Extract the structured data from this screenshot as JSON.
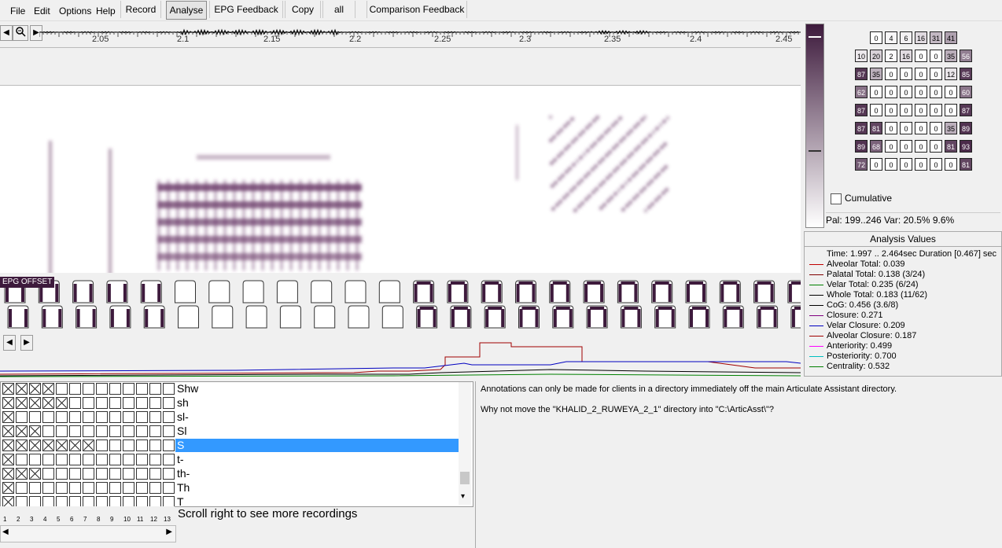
{
  "menu": {
    "file": "File",
    "edit": "Edit",
    "options": "Options",
    "help": "Help"
  },
  "toolbar": {
    "record": "Record",
    "analyse": "Analyse",
    "epg_feedback": "EPG Feedback",
    "copy": "Copy",
    "all": "all",
    "comparison_feedback": "Comparison Feedback"
  },
  "timeline": {
    "ticks": [
      "2.05",
      "2.1",
      "2.15",
      "2.2",
      "2.25",
      "2.3",
      "2.35",
      "2.4",
      "2.45"
    ]
  },
  "epg_offset_label": "EPG OFFSET",
  "epg_grid": [
    [
      null,
      0,
      4,
      6,
      16,
      31,
      41,
      null
    ],
    [
      10,
      20,
      2,
      16,
      0,
      0,
      35,
      56
    ],
    [
      87,
      35,
      0,
      0,
      0,
      0,
      12,
      85
    ],
    [
      62,
      0,
      0,
      0,
      0,
      0,
      0,
      60
    ],
    [
      87,
      0,
      0,
      0,
      0,
      0,
      0,
      87
    ],
    [
      87,
      81,
      0,
      0,
      0,
      0,
      35,
      89
    ],
    [
      89,
      68,
      0,
      0,
      0,
      0,
      81,
      93
    ],
    [
      72,
      0,
      0,
      0,
      0,
      0,
      0,
      81
    ]
  ],
  "cumulative_label": "Cumulative",
  "pal_var": "Pal: 199..246 Var: 20.5%  9.6%",
  "analysis": {
    "title": "Analysis Values",
    "rows": [
      {
        "text": "Time: 1.997 .. 2.464sec Duration [0.467] sec",
        "color": ""
      },
      {
        "text": "Alveolar Total: 0.039",
        "color": "#c00000"
      },
      {
        "text": "Palatal Total: 0.138 (3/24)",
        "color": "#800000"
      },
      {
        "text": "Velar Total: 0.235 (6/24)",
        "color": "#008000"
      },
      {
        "text": "Whole Total: 0.183 (11/62)",
        "color": "#000000"
      },
      {
        "text": "CoG: 0.456 (3.6/8)",
        "color": "#000000"
      },
      {
        "text": "Closure: 0.271",
        "color": "#800080"
      },
      {
        "text": "Velar Closure: 0.209",
        "color": "#0000c0"
      },
      {
        "text": "Alveolar Closure: 0.187",
        "color": "#a00000"
      },
      {
        "text": "Anteriority: 0.499",
        "color": "#ff00ff"
      },
      {
        "text": "Posteriority: 0.700",
        "color": "#00c0c0"
      },
      {
        "text": "Centrality: 0.532",
        "color": "#008000"
      }
    ]
  },
  "list": {
    "rows": [
      {
        "name": "Shw",
        "checked": 4
      },
      {
        "name": "sh",
        "checked": 5
      },
      {
        "name": "sl-",
        "checked": 1
      },
      {
        "name": "Sl",
        "checked": 3
      },
      {
        "name": "S",
        "checked": 7,
        "selected": true
      },
      {
        "name": "t-",
        "checked": 1
      },
      {
        "name": "th-",
        "checked": 3
      },
      {
        "name": "Th",
        "checked": 1
      },
      {
        "name": "T",
        "checked": 1
      }
    ],
    "columns": [
      "1",
      "2",
      "3",
      "4",
      "5",
      "6",
      "7",
      "8",
      "9",
      "10",
      "11",
      "12",
      "13"
    ],
    "scroll_message": "Scroll right to see more recordings"
  },
  "annotations": {
    "line1": "Annotations can only be made for clients in a directory immediately off the main Articulate Assistant directory.",
    "line2": "Why not move the \"KHALID_2_RUWEYA_2_1\" directory into \"C:\\ArticAsst\\\"?"
  }
}
